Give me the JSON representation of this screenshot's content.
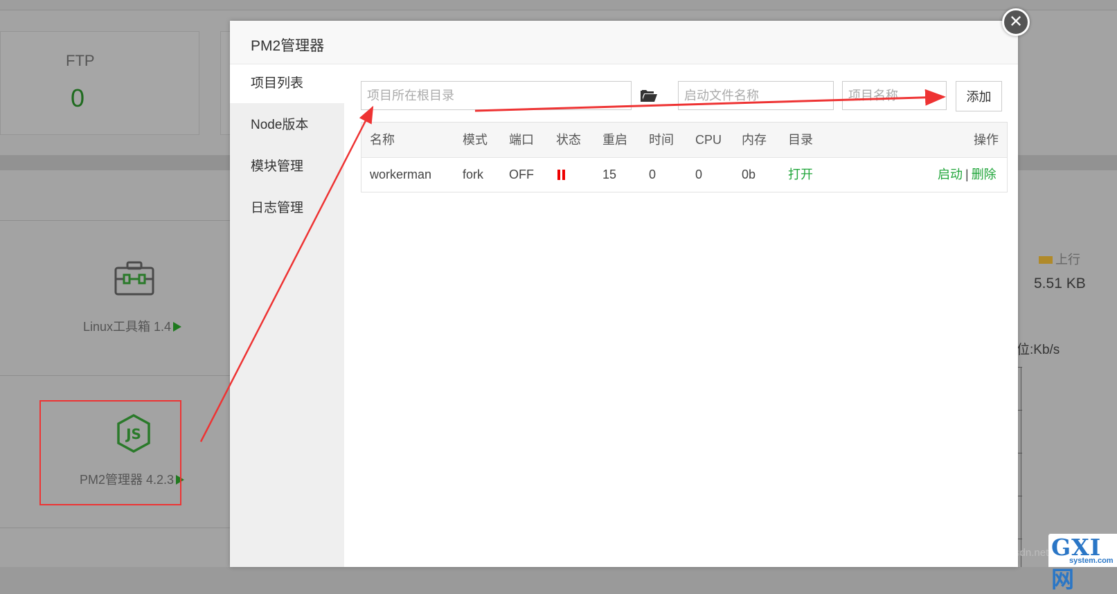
{
  "background": {
    "ftp_title": "FTP",
    "ftp_value": "0",
    "apps": [
      {
        "label": "Linux工具箱 1.4",
        "icon": "toolbox-icon"
      },
      {
        "label": "PM2管理器 4.2.3",
        "icon": "nodejs-icon"
      }
    ],
    "traffic": {
      "legend": "上行",
      "value": "5.51 KB",
      "unit": "位:Kb/s"
    },
    "watermark": "https://blog.csdn.net",
    "logo_text": "GXI网",
    "logo_sub": "system.com"
  },
  "modal": {
    "title": "PM2管理器",
    "close_icon": "close-icon",
    "sidebar": [
      {
        "label": "项目列表",
        "active": true
      },
      {
        "label": "Node版本",
        "active": false
      },
      {
        "label": "模块管理",
        "active": false
      },
      {
        "label": "日志管理",
        "active": false
      }
    ],
    "form": {
      "root_dir_placeholder": "项目所在根目录",
      "start_file_placeholder": "启动文件名称",
      "project_name_placeholder": "项目名称",
      "folder_icon": "folder-open-icon",
      "add_label": "添加"
    },
    "table": {
      "headers": [
        "名称",
        "模式",
        "端口",
        "状态",
        "重启",
        "时间",
        "CPU",
        "内存",
        "目录",
        "操作"
      ],
      "rows": [
        {
          "name": "workerman",
          "mode": "fork",
          "port": "OFF",
          "status": "paused",
          "restart": "15",
          "time": "0",
          "cpu": "0",
          "memory": "0b",
          "dir": "打开",
          "action_start": "启动",
          "action_sep": "|",
          "action_delete": "删除"
        }
      ]
    }
  },
  "colors": {
    "accent_green": "#20a53a",
    "status_red": "#e00000",
    "annotation_red": "#e33333"
  }
}
